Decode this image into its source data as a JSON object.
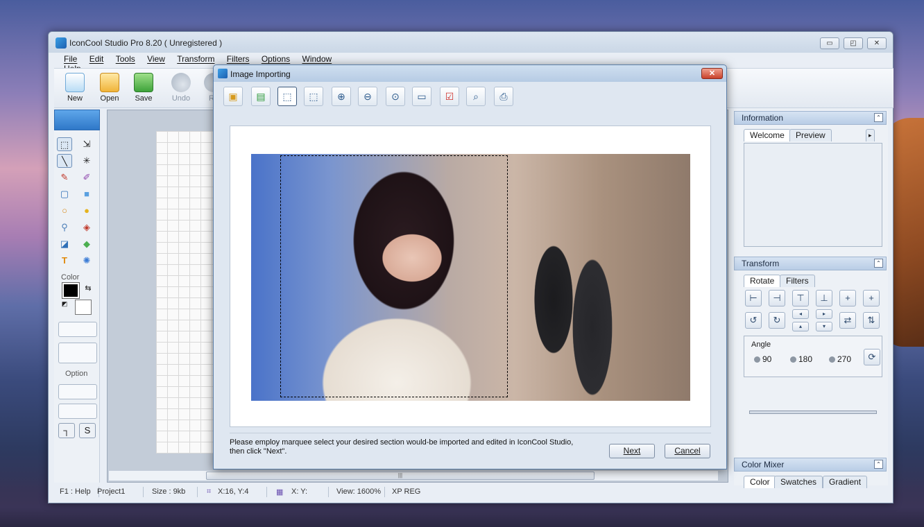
{
  "main_window": {
    "title": "IconCool Studio Pro 8.20 ( Unregistered )",
    "menu": [
      "File",
      "Edit",
      "Tools",
      "View",
      "Transform",
      "Filters",
      "Options",
      "Window",
      "Help"
    ],
    "toolbar": {
      "new": "New",
      "open": "Open",
      "save": "Save",
      "undo": "Undo",
      "redo": "Re"
    },
    "window_buttons": {
      "minimize": "▭",
      "restore": "◰",
      "close": "✕"
    }
  },
  "left_panel": {
    "color_label": "Color",
    "option_label": "Option",
    "foreground_color": "#000000",
    "background_color": "#ffffff"
  },
  "right_panel": {
    "information": {
      "title": "Information",
      "tabs": [
        "Welcome",
        "Preview"
      ],
      "collapse": "⌃"
    },
    "transform": {
      "title": "Transform",
      "tabs": [
        "Rotate",
        "Filters"
      ],
      "angle_label": "Angle",
      "angles": [
        "90",
        "180",
        "270"
      ]
    },
    "color_mixer": {
      "title": "Color Mixer",
      "tabs": [
        "Color",
        "Swatches",
        "Gradient"
      ]
    }
  },
  "status_bar": {
    "help": "F1 : Help",
    "project": "Project1",
    "size": "Size : 9kb",
    "cursor": "X:16, Y:4",
    "selection": "X:  Y:",
    "view": "View: 1600%",
    "mode": "XP REG"
  },
  "dialog": {
    "title": "Image Importing",
    "close": "✕",
    "message_line1": "Please employ marquee select your desired section would-be imported and edited in IconCool Studio,",
    "message_line2": " then click \"Next\".",
    "next_label": "Next",
    "cancel_label": "Cancel"
  }
}
